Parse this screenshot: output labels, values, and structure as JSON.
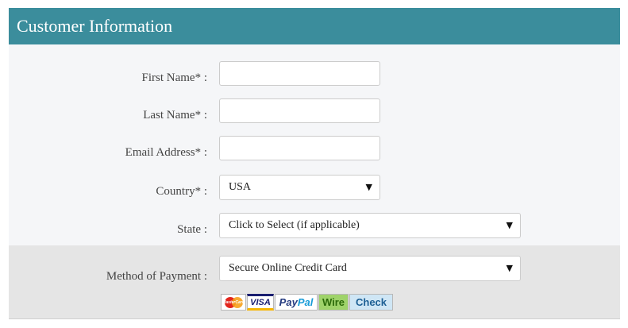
{
  "header": {
    "title": "Customer Information"
  },
  "form": {
    "first_name": {
      "label": "First Name* :",
      "value": ""
    },
    "last_name": {
      "label": "Last Name* :",
      "value": ""
    },
    "email": {
      "label": "Email Address* :",
      "value": ""
    },
    "country": {
      "label": "Country* :",
      "value": "USA"
    },
    "state": {
      "label": "State :",
      "value": "Click to Select (if applicable)"
    },
    "payment": {
      "label": "Method of Payment :",
      "value": "Secure Online Credit Card"
    }
  },
  "payment_logos": {
    "mastercard": "MasterCard",
    "visa": "VISA",
    "paypal_a": "Pay",
    "paypal_b": "Pal",
    "wire": "Wire",
    "check": "Check"
  },
  "icons": {
    "dropdown": "chevron-down-icon"
  },
  "colors": {
    "header_bg": "#3b8d9c",
    "form_bg": "#f5f6f8",
    "payment_bg": "#e5e5e5"
  }
}
